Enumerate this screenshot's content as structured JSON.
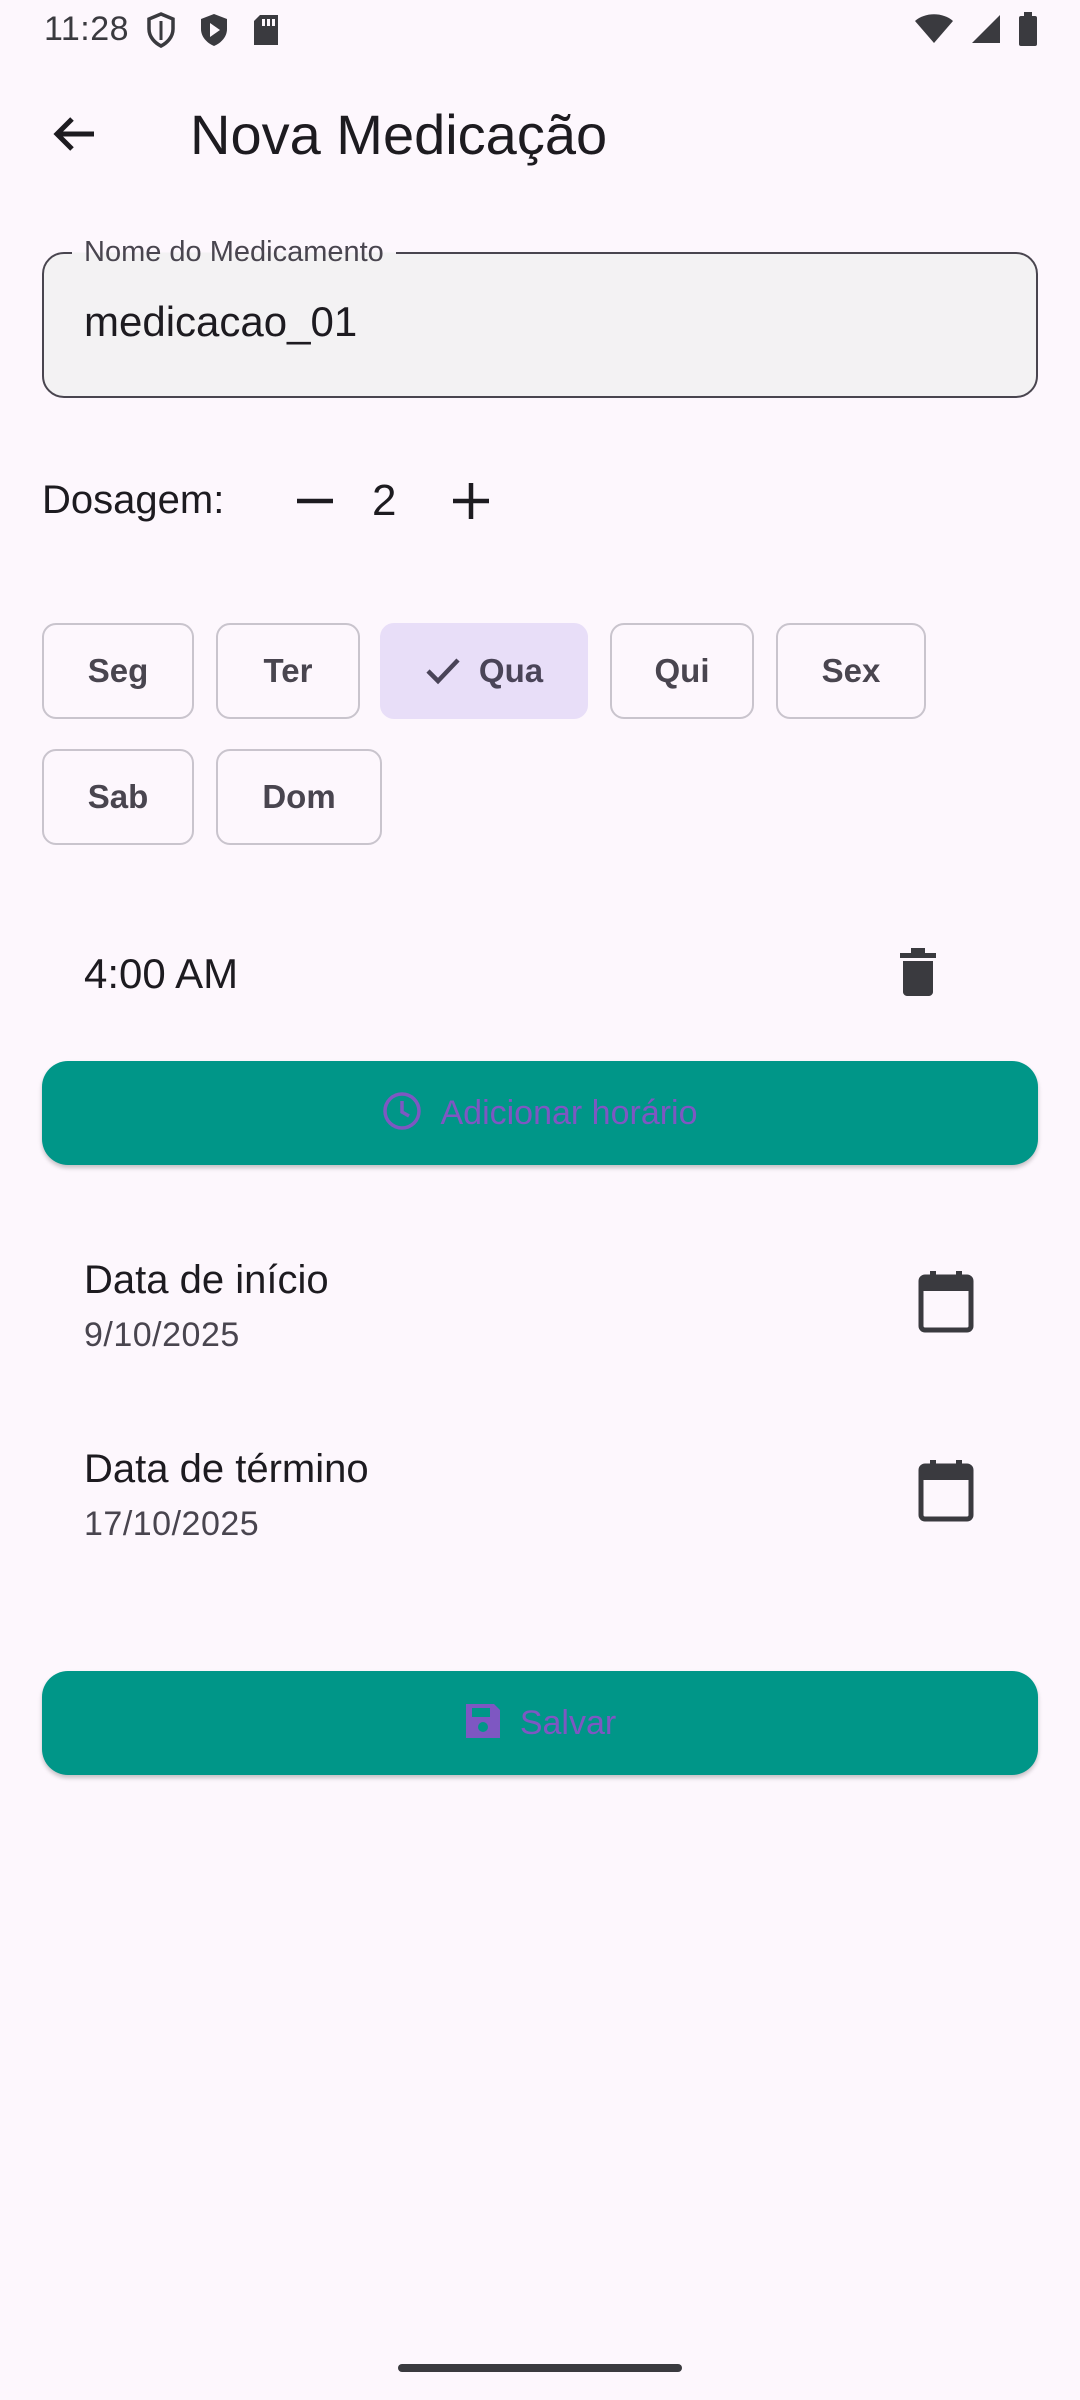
{
  "status_bar": {
    "time": "11:28",
    "left_icons": [
      "shield-icon",
      "play-protect-icon",
      "sd-card-icon"
    ],
    "right_icons": [
      "wifi-icon",
      "signal-icon",
      "battery-icon"
    ]
  },
  "app_bar": {
    "title": "Nova Medicação",
    "back_icon": "arrow-back-icon"
  },
  "medication_name": {
    "label": "Nome do Medicamento",
    "value": "medicacao_01"
  },
  "dosage": {
    "label": "Dosagem:",
    "value": "2",
    "decrement_icon": "minus-icon",
    "increment_icon": "plus-icon"
  },
  "days": [
    {
      "label": "Seg",
      "selected": false
    },
    {
      "label": "Ter",
      "selected": false
    },
    {
      "label": "Qua",
      "selected": true
    },
    {
      "label": "Qui",
      "selected": false
    },
    {
      "label": "Sex",
      "selected": false
    },
    {
      "label": "Sab",
      "selected": false
    },
    {
      "label": "Dom",
      "selected": false
    }
  ],
  "schedule": {
    "times": [
      "4:00 AM"
    ],
    "delete_icon": "trash-icon",
    "add_button_label": "Adicionar horário",
    "add_button_icon": "clock-icon"
  },
  "start_date": {
    "label": "Data de início",
    "value": "9/10/2025",
    "icon": "calendar-icon"
  },
  "end_date": {
    "label": "Data de término",
    "value": "17/10/2025",
    "icon": "calendar-icon"
  },
  "save_button": {
    "label": "Salvar",
    "icon": "save-icon"
  },
  "colors": {
    "background": "#fdf7fd",
    "button_fill": "#009688",
    "button_text": "#7e57c2",
    "chip_selected": "#e8def8"
  }
}
